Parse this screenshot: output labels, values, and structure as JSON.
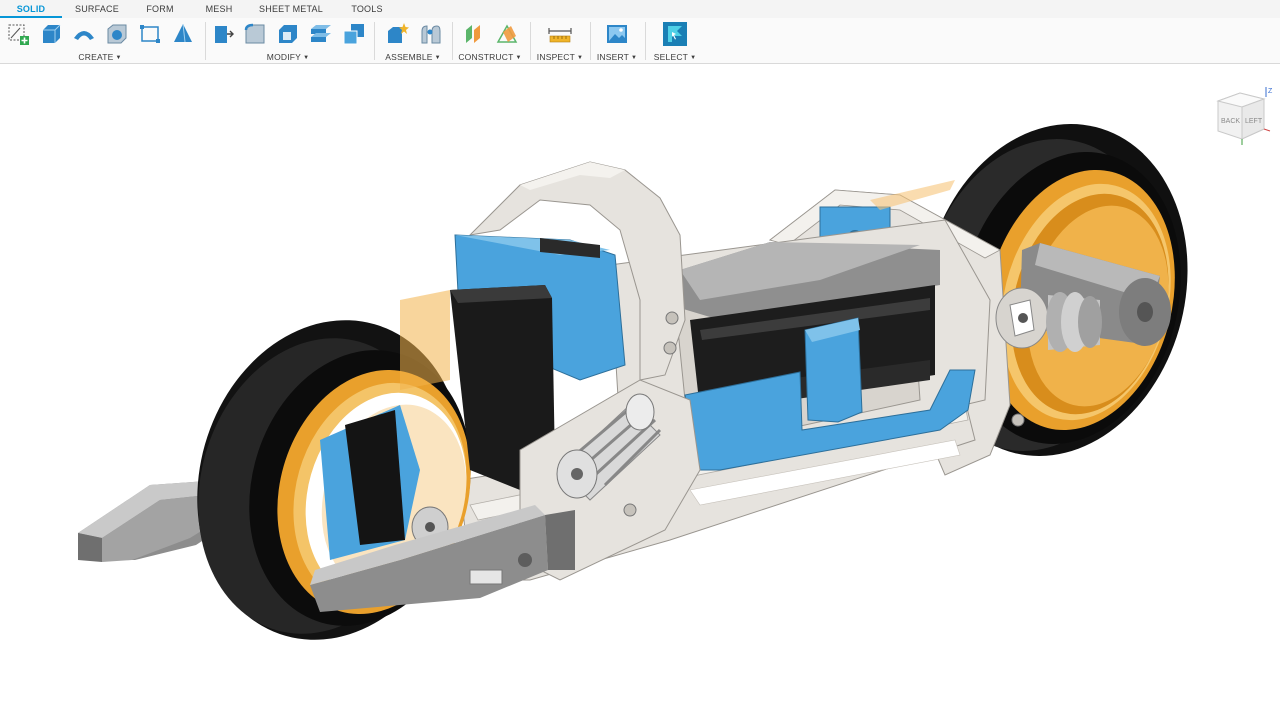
{
  "tabs": [
    {
      "label": "SOLID",
      "active": true
    },
    {
      "label": "SURFACE",
      "active": false
    },
    {
      "label": "FORM",
      "active": false
    },
    {
      "label": "MESH",
      "active": false
    },
    {
      "label": "SHEET METAL",
      "active": false
    },
    {
      "label": "TOOLS",
      "active": false
    }
  ],
  "groups": {
    "create": {
      "label": "CREATE",
      "icons": [
        "new-sketch-icon",
        "extrude-icon",
        "revolve-icon",
        "hole-icon",
        "sketch-rectangle-icon",
        "pyramid-icon"
      ]
    },
    "modify": {
      "label": "MODIFY",
      "icons": [
        "press-pull-icon",
        "fillet-icon",
        "shell-icon",
        "split-body-icon",
        "combine-icon"
      ]
    },
    "assemble": {
      "label": "ASSEMBLE",
      "icons": [
        "new-component-icon",
        "joint-icon"
      ]
    },
    "construct": {
      "label": "CONSTRUCT",
      "icons": [
        "offset-plane-icon",
        "plane-at-angle-icon"
      ]
    },
    "inspect": {
      "label": "INSPECT",
      "icons": [
        "measure-icon"
      ]
    },
    "insert": {
      "label": "INSERT",
      "icons": [
        "insert-image-icon"
      ]
    },
    "select": {
      "label": "SELECT",
      "icons": [
        "select-icon"
      ]
    }
  },
  "viewcube": {
    "faces": [
      "BACK",
      "LEFT"
    ],
    "axis": "Z"
  },
  "colors": {
    "accent": "#0696d7",
    "part_blue": "#4aa3dd",
    "frame": "#e6e3de",
    "tire": "#141414",
    "rim": "#e9a02c"
  }
}
